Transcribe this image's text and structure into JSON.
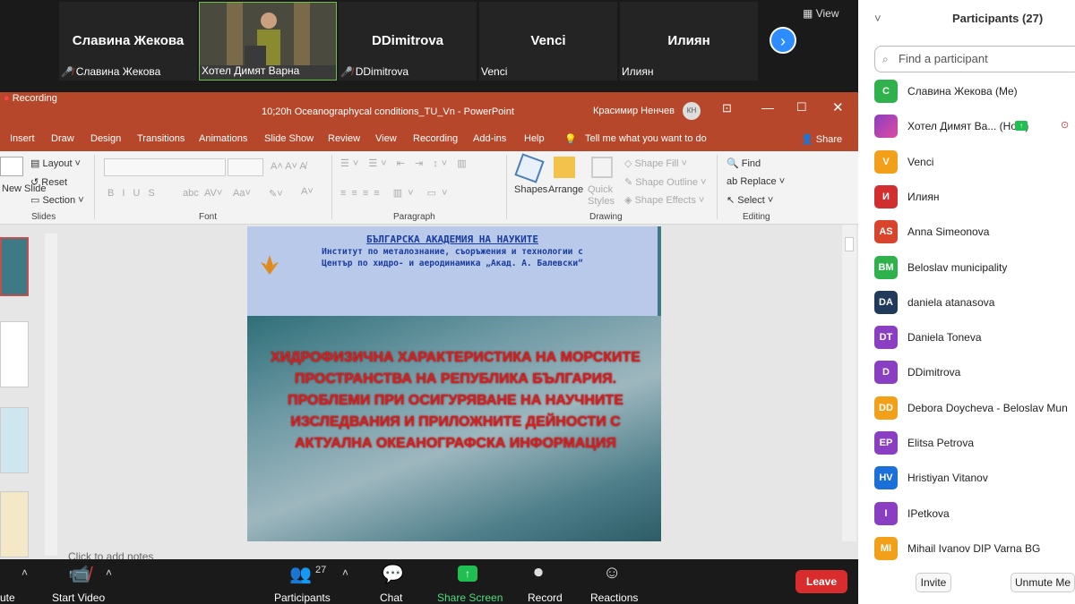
{
  "gallery": {
    "tiles": [
      {
        "name": "Славина Жекова",
        "label": "Славина Жекова"
      },
      {
        "label": "Хотел Димят Варна"
      },
      {
        "name": "DDimitrova",
        "label": "DDimitrova"
      },
      {
        "name": "Venci",
        "label": "Venci"
      },
      {
        "name": "Илиян",
        "label": "Илиян"
      }
    ],
    "view_label": "View"
  },
  "ppt": {
    "recording_badge": "Recording",
    "title": "10;20h  Oceanographycal conditions_TU_Vn  -  PowerPoint",
    "user": "Красимир Ненчев",
    "user_initials": "КН",
    "menu": [
      "Insert",
      "Draw",
      "Design",
      "Transitions",
      "Animations",
      "Slide Show",
      "Review",
      "View",
      "Recording",
      "Add-ins",
      "Help"
    ],
    "tell_me": "Tell me what you want to do",
    "share": "Share",
    "ribbon": {
      "new_slide": "New Slide",
      "layout": "Layout",
      "reset": "Reset",
      "section": "Section",
      "slides_group": "Slides",
      "font_group": "Font",
      "paragraph_group": "Paragraph",
      "drawing_group": "Drawing",
      "editing_group": "Editing",
      "shapes": "Shapes",
      "arrange": "Arrange",
      "quick_styles": "Quick Styles",
      "shape_fill": "Shape Fill",
      "shape_outline": "Shape Outline",
      "shape_effects": "Shape Effects",
      "find": "Find",
      "replace": "Replace",
      "select": "Select"
    },
    "slide": {
      "head1": "БЪЛГАРСКА АКАДЕМИЯ НА НАУКИТЕ",
      "head2": "Институт по металознание, съоръжения и технологии с",
      "head3": "Център по хидро- и аеродинамика „Акад. А. Балевски“",
      "title": "ХИДРОФИЗИЧНА ХАРАКТЕРИСТИКА НА МОРСКИТЕ ПРОСТРАНСТВА НА РЕПУБЛИКА БЪЛГАРИЯ. ПРОБЛЕМИ ПРИ ОСИГУРЯВАНЕ НА НАУЧНИТЕ ИЗСЛЕДВАНИЯ И ПРИЛОЖНИТЕ ДЕЙНОСТИ С АКТУАЛНА ОКЕАНОГРАФСКА ИНФОРМАЦИЯ"
    },
    "notes_placeholder": "Click to add notes"
  },
  "toolbar": {
    "mute": "ute",
    "start_video": "Start Video",
    "participants": "Participants",
    "participants_count": "27",
    "chat": "Chat",
    "share_screen": "Share Screen",
    "record": "Record",
    "reactions": "Reactions",
    "leave": "Leave"
  },
  "panel": {
    "title": "Participants (27)",
    "search_placeholder": "Find a participant",
    "participants": [
      {
        "initials": "С",
        "name": "Славина Жекова (Me)",
        "color": "#2fb24c"
      },
      {
        "initials": "",
        "name": "Хотел Димят Ва...  (Host)",
        "color": "#c050c0"
      },
      {
        "initials": "V",
        "name": "Venci",
        "color": "#f2a019"
      },
      {
        "initials": "И",
        "name": "Илиян",
        "color": "#d12f2f"
      },
      {
        "initials": "AS",
        "name": "Anna Simeonova",
        "color": "#d8452c"
      },
      {
        "initials": "BM",
        "name": "Beloslav municipality",
        "color": "#2fb24c"
      },
      {
        "initials": "DA",
        "name": "daniela atanasova",
        "color": "#1f3a5a"
      },
      {
        "initials": "DT",
        "name": "Daniela Toneva",
        "color": "#8a3fc2"
      },
      {
        "initials": "D",
        "name": "DDimitrova",
        "color": "#8a3fc2"
      },
      {
        "initials": "DD",
        "name": "Debora Doycheva -  Beloslav Mun",
        "color": "#f2a019"
      },
      {
        "initials": "EP",
        "name": "Elitsa Petrova",
        "color": "#8a3fc2"
      },
      {
        "initials": "HV",
        "name": "Hristiyan Vitanov",
        "color": "#1a6fd8"
      },
      {
        "initials": "I",
        "name": "IPetkova",
        "color": "#8a3fc2"
      },
      {
        "initials": "MI",
        "name": "Mihail Ivanov DIP Varna BG",
        "color": "#f2a019"
      }
    ],
    "invite": "Invite",
    "unmute_me": "Unmute Me"
  }
}
